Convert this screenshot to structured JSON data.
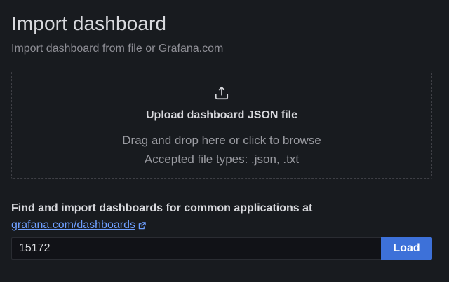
{
  "header": {
    "title": "Import dashboard",
    "subtitle": "Import dashboard from file or Grafana.com"
  },
  "upload": {
    "icon": "upload-icon",
    "title": "Upload dashboard JSON file",
    "hint": "Drag and drop here or click to browse",
    "accepted_types": "Accepted file types: .json, .txt"
  },
  "grafana_com": {
    "label": "Find and import dashboards for common applications at",
    "link_text": "grafana.com/dashboards",
    "link_icon": "external-link-icon",
    "input_value": "15172",
    "load_label": "Load"
  },
  "colors": {
    "background": "#181b1f",
    "link": "#6e9fff",
    "primary_button": "#3d71d9"
  }
}
